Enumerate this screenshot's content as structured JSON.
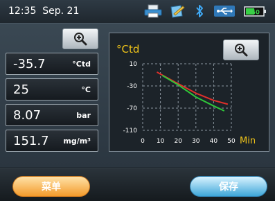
{
  "status": {
    "time": "12:35",
    "date": "Sep. 21",
    "icons": [
      "printer-icon",
      "edit-icon",
      "bluetooth-icon",
      "usb-icon",
      "battery-icon"
    ],
    "battery_label": "50"
  },
  "readings": [
    {
      "value": "-35.7",
      "unit": "°Ctd"
    },
    {
      "value": "25",
      "unit": "°C"
    },
    {
      "value": "8.07",
      "unit": "bar"
    },
    {
      "value": "151.7",
      "unit": "mg/m³"
    }
  ],
  "buttons": {
    "menu": "菜单",
    "save": "保存"
  },
  "colors": {
    "accent_orange": "#f39a2b",
    "accent_blue": "#3ea6d9",
    "unit_yellow": "#f0c419",
    "series_red": "#e0302a",
    "series_green": "#2fc83a"
  },
  "chart_data": {
    "type": "line",
    "ylabel": "°Ctd",
    "xlabel": "Min",
    "ylim": [
      -110,
      10
    ],
    "xlim": [
      0,
      50
    ],
    "y_ticks": [
      "10",
      "-30",
      "-70",
      "-110"
    ],
    "x_ticks": [
      "0",
      "10",
      "20",
      "30",
      "40",
      "50"
    ],
    "grid": true,
    "series": [
      {
        "color": "#e0302a",
        "x": [
          8,
          20,
          30,
          40,
          48
        ],
        "y": [
          -5,
          -26,
          -43,
          -56,
          -63
        ]
      },
      {
        "color": "#2fc83a",
        "x": [
          11,
          20,
          30,
          40,
          46
        ],
        "y": [
          -11,
          -28,
          -50,
          -66,
          -75
        ]
      }
    ]
  }
}
